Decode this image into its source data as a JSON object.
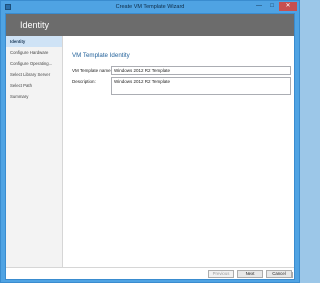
{
  "window": {
    "title": "Create VM Template Wizard",
    "minimize_glyph": "—",
    "maximize_glyph": "□",
    "close_glyph": "✕"
  },
  "banner": {
    "title": "Identity"
  },
  "nav": {
    "items": [
      {
        "label": "Identity",
        "active": true
      },
      {
        "label": "Configure Hardware"
      },
      {
        "label": "Configure Operating..."
      },
      {
        "label": "Select Library Server"
      },
      {
        "label": "Select Path"
      },
      {
        "label": "Summary"
      }
    ]
  },
  "content": {
    "section_title": "VM Template Identity",
    "name_label": "VM Template name:",
    "name_value": "Windows 2012 R2 Template",
    "description_label": "Description:",
    "description_value": "Windows 2012 R2 Template"
  },
  "footer": {
    "previous_label": "Previous",
    "next_label": "Next",
    "cancel_label": "Cancel"
  },
  "colors": {
    "titlebar": "#4fa3e3",
    "banner": "#6c6c6c",
    "accent": "#1f5f99",
    "nav_active": "#cfe3f6"
  }
}
